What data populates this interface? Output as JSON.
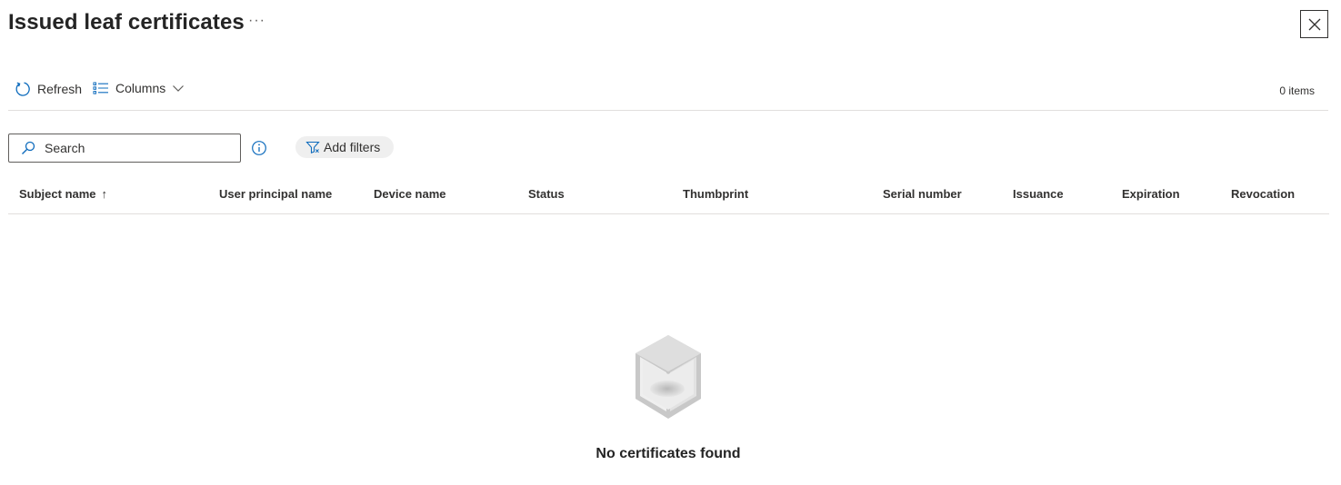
{
  "panel": {
    "title": "Issued leaf certificates",
    "more_label": "···"
  },
  "toolbar": {
    "refresh_label": "Refresh",
    "columns_label": "Columns",
    "items_count": "0 items"
  },
  "filters": {
    "search_placeholder": "Search",
    "add_filters_label": "Add filters"
  },
  "table": {
    "columns": [
      "Subject name",
      "User principal name",
      "Device name",
      "Status",
      "Thumbprint",
      "Serial number",
      "Issuance",
      "Expiration",
      "Revocation"
    ],
    "sort_indicator": "↑",
    "empty_message": "No certificates found"
  },
  "colors": {
    "accent": "#0f6cbd",
    "border": "#e1dfdd",
    "chip_bg": "#efefef",
    "text": "#323130"
  },
  "icons": {
    "refresh": "refresh-icon",
    "columns": "list-columns-icon",
    "chevron": "chevron-down-icon",
    "close": "close-icon",
    "search": "search-icon",
    "info": "info-icon",
    "filter": "filter-icon",
    "empty": "empty-cube-icon"
  }
}
